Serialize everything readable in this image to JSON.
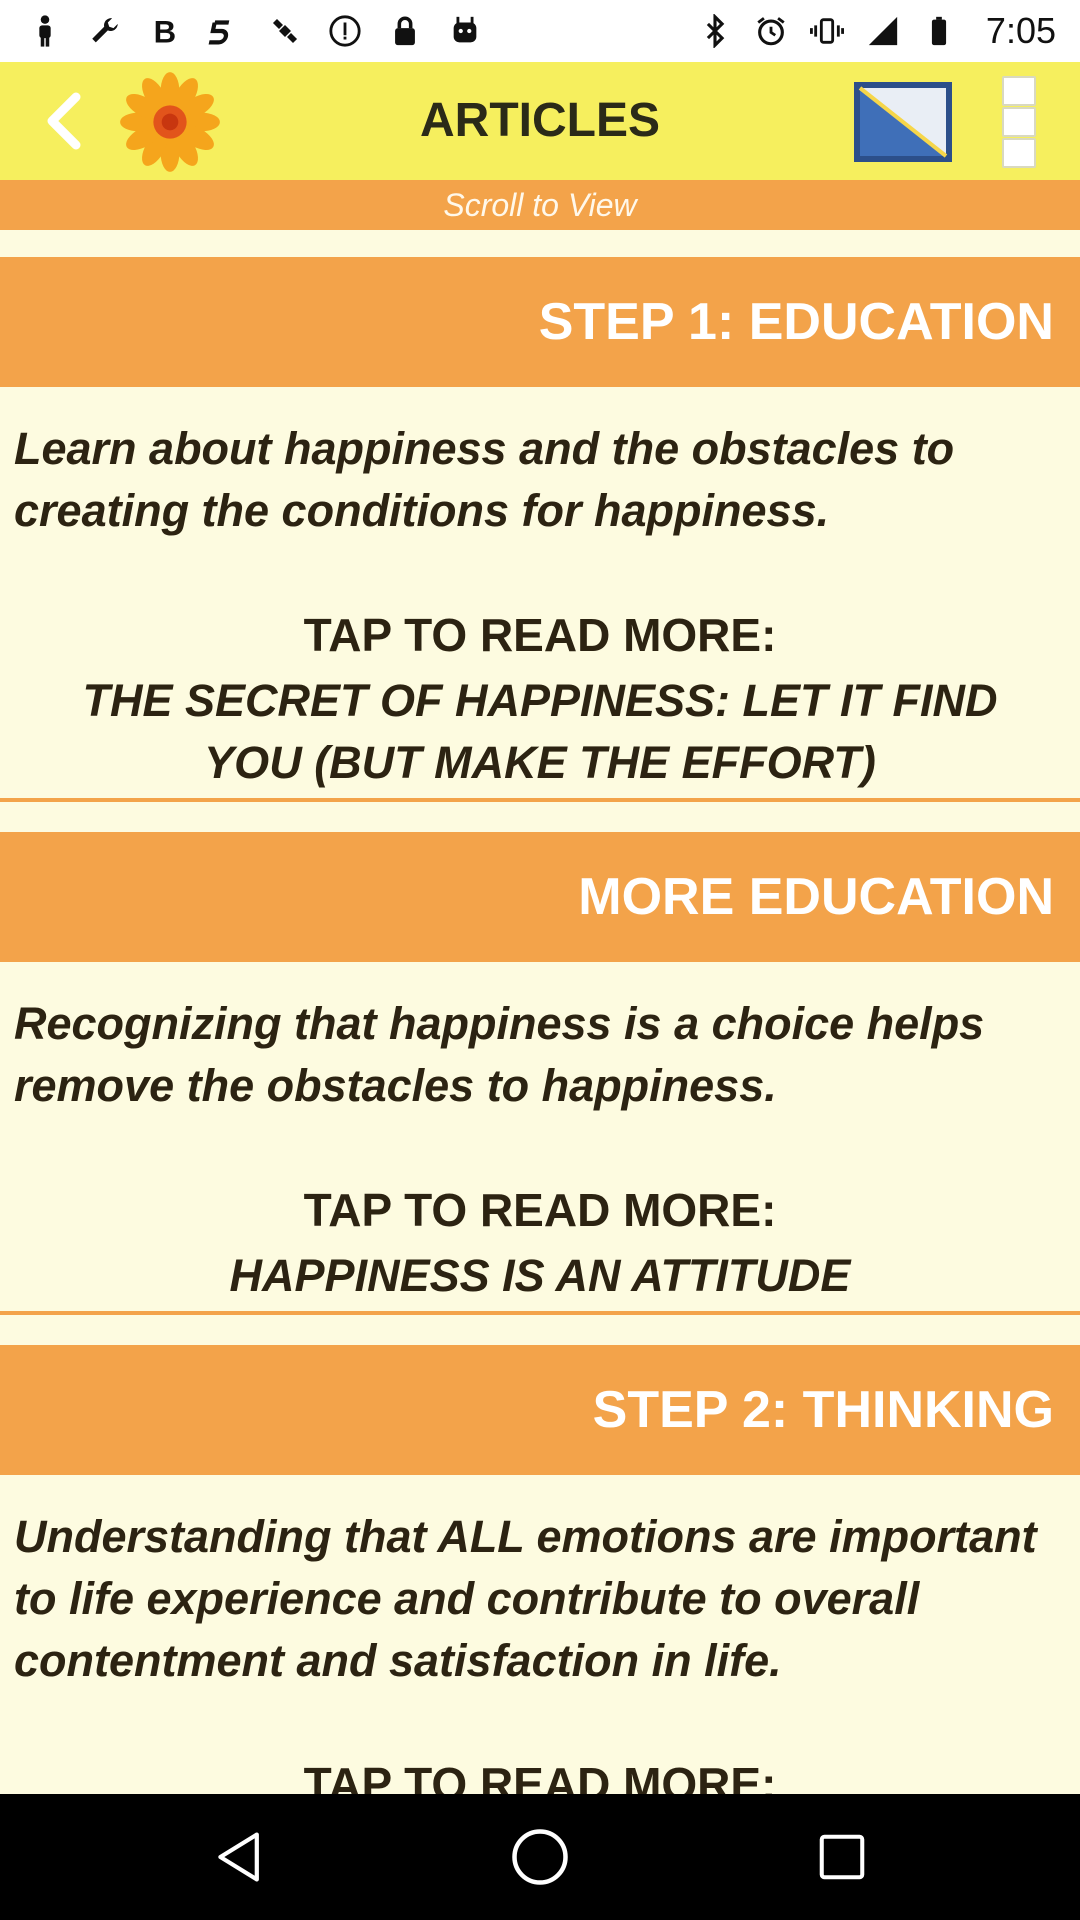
{
  "status_bar": {
    "time": "7:05",
    "left_icons": [
      "person-icon",
      "wrench-icon",
      "bold-b-icon",
      "gesture-icon",
      "satellite-icon",
      "info-circle-icon",
      "lock-icon",
      "android-icon"
    ],
    "right_icons": [
      "bluetooth-icon",
      "alarm-icon",
      "vibrate-icon",
      "signal-icon",
      "battery-icon"
    ]
  },
  "app_bar": {
    "title": "ARTICLES",
    "background": "#f6ef5e"
  },
  "scroll_hint": "Scroll to View",
  "sections": [
    {
      "header": "STEP 1: EDUCATION",
      "description": "Learn about happiness and the obstacles to creating the conditions for happiness.",
      "tap_label": "TAP TO READ MORE:",
      "article_title": "THE SECRET OF HAPPINESS: LET IT FIND YOU (BUT MAKE THE EFFORT)"
    },
    {
      "header": "MORE EDUCATION",
      "description": "Recognizing that happiness is a choice helps remove the obstacles to happiness.",
      "tap_label": "TAP TO READ MORE:",
      "article_title": "HAPPINESS IS AN ATTITUDE"
    },
    {
      "header": "STEP 2: THINKING",
      "description": "Understanding that ALL emotions are important to life experience and contribute to overall contentment and satisfaction in life.",
      "tap_label": "TAP TO READ MORE:"
    }
  ],
  "colors": {
    "accent": "#f3a34a",
    "content_bg": "#fdfbe0",
    "text": "#2c2312"
  }
}
